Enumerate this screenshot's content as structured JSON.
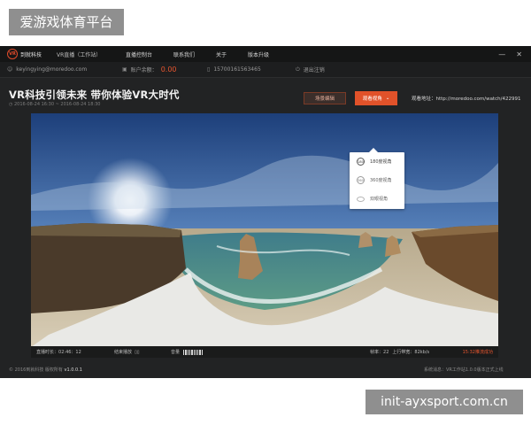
{
  "watermark": {
    "top_label": "爱游戏体育平台",
    "bottom_label": "init-ayxsport.com.cn"
  },
  "titlebar": {
    "logo_mark": "VR",
    "logo_text": "到就科技",
    "app_name": "VR直播（工作站）",
    "nav": [
      "直播控制台",
      "联系我们",
      "关于",
      "版本升级"
    ],
    "minimize_icon": "minimize-icon",
    "close_icon": "close-icon"
  },
  "infobar": {
    "email": "keyingying@moredoo.com",
    "balance_label": "账户余额：",
    "balance_value": "0.00",
    "phone": "15700161563465",
    "logout": "退出注销"
  },
  "stream": {
    "title": "VR科技引领未来 带你体验VR大时代",
    "date_range": "2016-08-24 16:30 ~ 2016-08-24 18:30",
    "scene_button": "场景编辑",
    "view_button": "观看视角",
    "watch_address": "观看地址：http://moredoo.com/watch/422991"
  },
  "view_menu": {
    "options": [
      {
        "icon": "180",
        "label": "180度视角"
      },
      {
        "icon": "360",
        "label": "360度视角"
      },
      {
        "icon": "eye",
        "label": "双眼视角"
      }
    ],
    "selected": "180度视角"
  },
  "statusbar": {
    "duration_label": "直播时长：",
    "duration_value": "02:46：12",
    "end_playback": "结束播放",
    "volume_label": "音量",
    "fps_label": "帧率：",
    "fps_value": "22",
    "upload_label": "上行带宽：",
    "upload_value": "82kb/s",
    "record_status": "15:32推流成功"
  },
  "footer": {
    "copyright": "© 2016到就科技 版权所有",
    "version": "v1.0.0.1",
    "system_status": "系统消息：VR工作站1.0.0版本正式上线"
  },
  "colors": {
    "accent": "#e1522a",
    "app_bg": "#222324",
    "titlebar_bg": "#151616"
  }
}
